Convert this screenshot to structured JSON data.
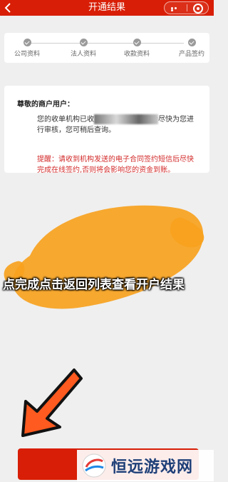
{
  "header": {
    "title": "开通结果",
    "background": "#d81e06"
  },
  "steps": [
    {
      "label": "公司资料"
    },
    {
      "label": "法人资料"
    },
    {
      "label": "收款资料"
    },
    {
      "label": "产品签约"
    }
  ],
  "card": {
    "greeting": "尊敬的商户用户：",
    "paragraph": "您的收单机构已收到您的开户申请，会尽快为您进行审核，您可稍后查询。",
    "paragraph_visible_prefix": "您的收单机",
    "paragraph_visible_suffix": "有限公司已收到您的开户申请，会尽快为您进行审核，您可稍后查询。",
    "warning": "提醒：请收到机构发送的电子合同签约短信后尽快完成在线签约,否则将会影响您的资金到账。"
  },
  "annotation": {
    "instruction": "点完成点击返回列表查看开户结果",
    "highlight_color": "#f7a21e",
    "arrow_color": "#ff5a1f"
  },
  "watermark": {
    "text": "恒远游戏网"
  }
}
